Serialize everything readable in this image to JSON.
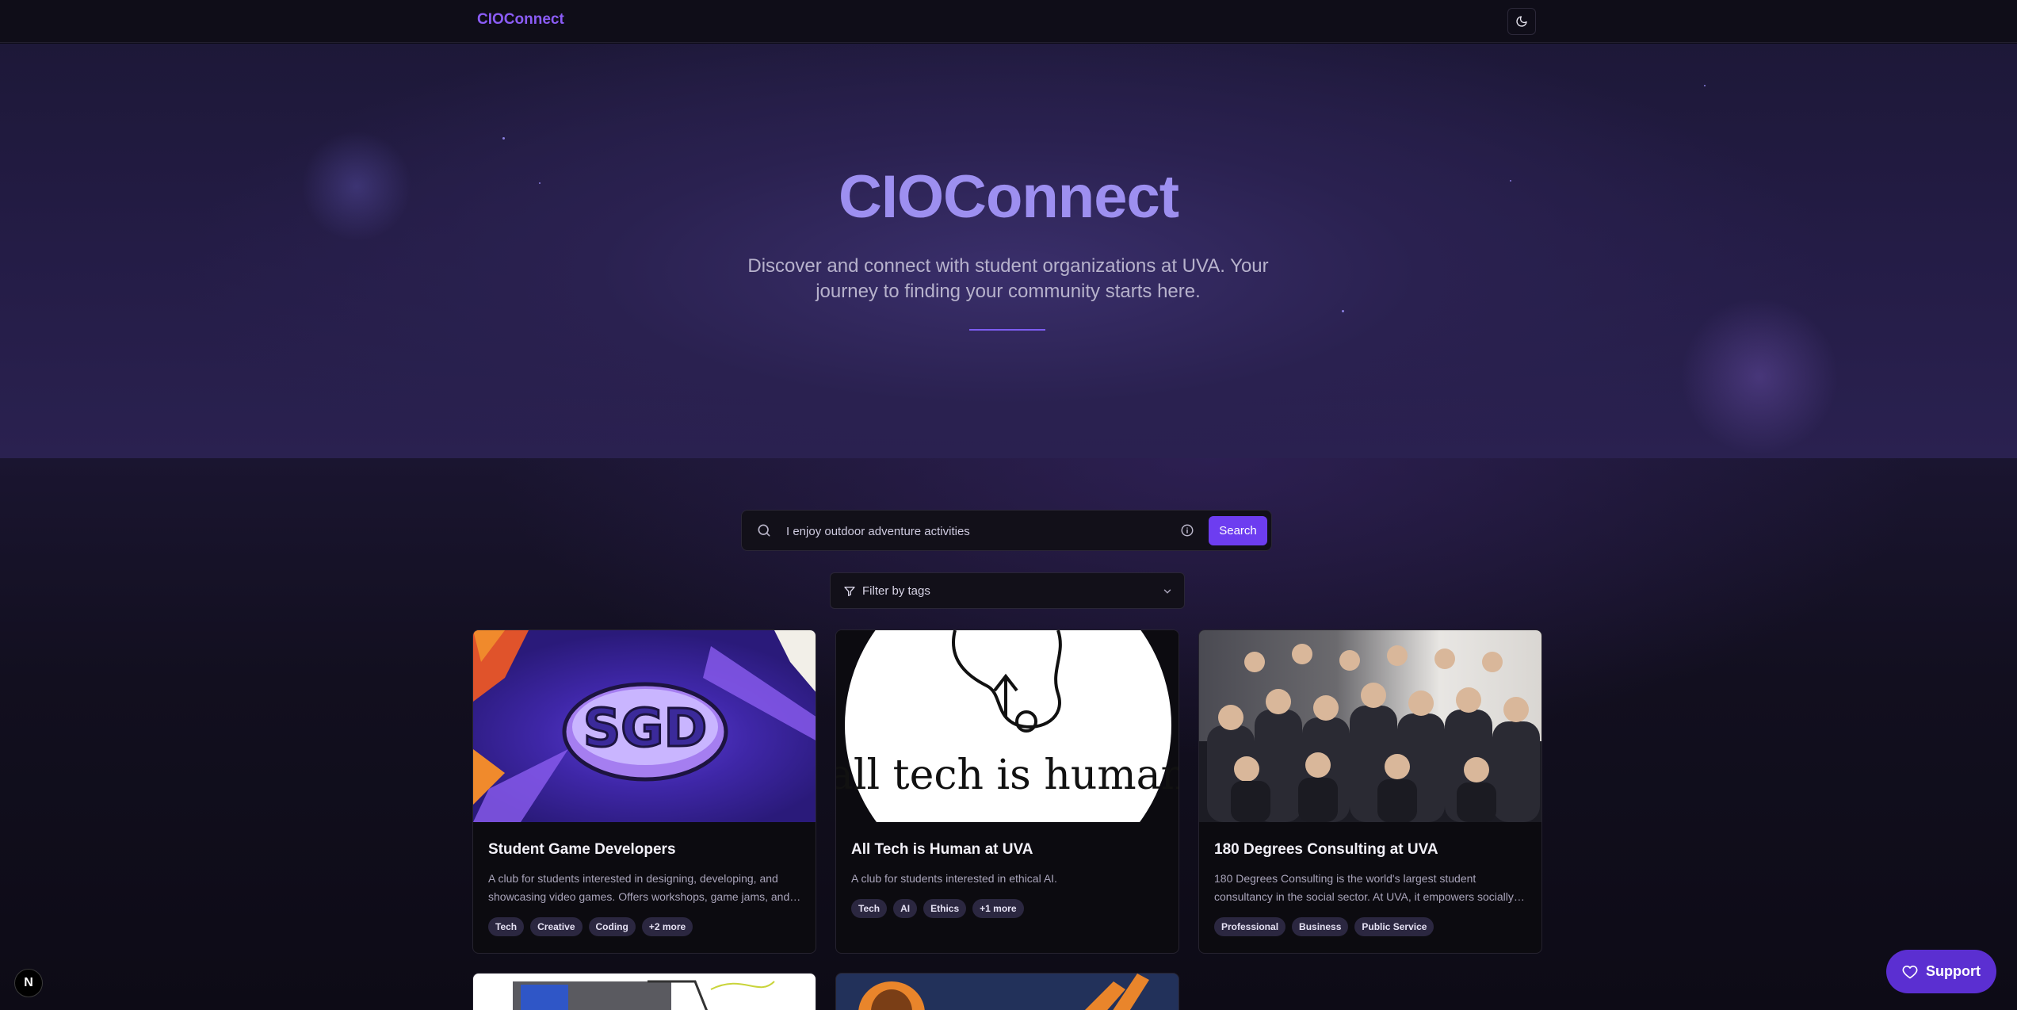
{
  "nav": {
    "brand": "CIOConnect",
    "theme_icon": "moon-icon"
  },
  "hero": {
    "title": "CIOConnect",
    "subtitle": "Discover and connect with student organizations at UVA. Your journey to finding your community starts here."
  },
  "search": {
    "value": "I enjoy outdoor adventure activities",
    "button": "Search"
  },
  "filter": {
    "label": "Filter by tags"
  },
  "cards": [
    {
      "title": "Student Game Developers",
      "description": "A club for students interested in designing, developing, and showcasing video games. Offers workshops, game jams, and more opportunities.",
      "tags": [
        "Tech",
        "Creative",
        "Coding",
        "+2 more"
      ],
      "image_text": "SGD"
    },
    {
      "title": "All Tech is Human at UVA",
      "description": "A club for students interested in ethical AI.",
      "tags": [
        "Tech",
        "AI",
        "Ethics",
        "+1 more"
      ],
      "image_text": "all tech is human"
    },
    {
      "title": "180 Degrees Consulting at UVA",
      "description": "180 Degrees Consulting is the world's largest student consultancy in the social sector. At UVA, it empowers socially conscious students.",
      "tags": [
        "Professional",
        "Business",
        "Public Service"
      ]
    }
  ],
  "support": {
    "label": "Support"
  },
  "dev_badge": {
    "label": "N"
  },
  "colors": {
    "accent": "#6d3df0",
    "brand": "#8b5cf6",
    "title": "#9d8ff0"
  }
}
